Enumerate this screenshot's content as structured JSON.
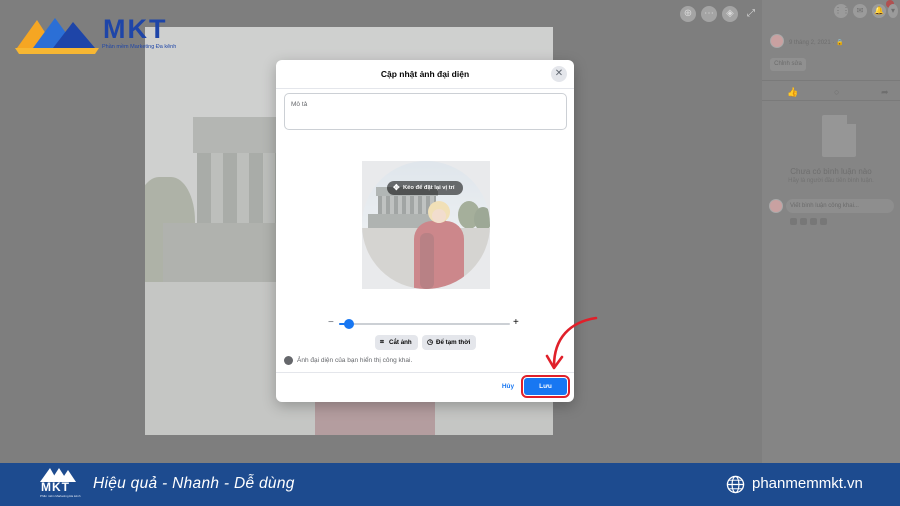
{
  "brand": {
    "name": "MKT",
    "tagline": "Phần mềm Marketing Đa kênh",
    "slogan": "Hiệu quả - Nhanh - Dễ dùng",
    "website": "phanmemmkt.vn",
    "colors": {
      "primary": "#1e45a8",
      "banner": "#1d4b8f",
      "accent": "#f5a623"
    }
  },
  "viewer": {
    "icons": [
      "zoom-in-icon",
      "more-icon",
      "tag-icon",
      "fullscreen-icon"
    ]
  },
  "side_panel": {
    "date": "9 tháng 2, 2021 · 🔒",
    "edit_label": "Chỉnh sửa",
    "empty_title": "Chưa có bình luận nào",
    "empty_subtitle": "Hãy là người đầu tiên bình luận.",
    "comment_placeholder": "Viết bình luận công khai..."
  },
  "dialog": {
    "title": "Cập nhật ảnh đại diện",
    "close_symbol": "✕",
    "description_placeholder": "Mô tả",
    "drag_hint": "Kéo để đặt lại vị trí",
    "zoom_minus": "−",
    "zoom_plus": "+",
    "zoom_level": 0.06,
    "crop_label": "Cắt ảnh",
    "temporary_label": "Để tạm thời",
    "public_notice": "Ảnh đại diện của bạn hiển thị công khai.",
    "cancel_label": "Hủy",
    "save_label": "Lưu",
    "colors": {
      "accent": "#1877f2",
      "highlight": "#e0202a"
    }
  }
}
